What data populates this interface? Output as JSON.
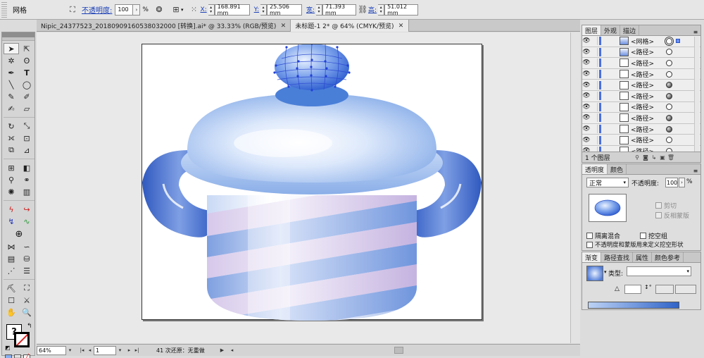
{
  "control_bar": {
    "mode_label": "网格",
    "opacity_link": "不透明度:",
    "opacity_value": "100",
    "opacity_unit": "%",
    "x_label": "X:",
    "x_value": "168.891 mm",
    "y_label": "Y:",
    "y_value": "25.506 mm",
    "w_label": "宽:",
    "w_value": "71.393 mm",
    "h_label": "高:",
    "h_value": "51.012 mm"
  },
  "doc_tabs": [
    {
      "label": "Nipic_24377523_20180909160538032000 [转换].ai* @ 33.33% (RGB/预览)"
    },
    {
      "label": "未标题-1 2* @ 64% (CMYK/预览)"
    }
  ],
  "status_bar": {
    "zoom": "64%",
    "page": "1",
    "message": "41 次还原：无重做"
  },
  "layers_panel": {
    "tabs": [
      "图层",
      "外观",
      "描边"
    ],
    "rows": [
      {
        "name": "<网格>",
        "target": "dbl",
        "selected": true,
        "thumb": "grad"
      },
      {
        "name": "<路径>",
        "target": "empty",
        "selected": false,
        "thumb": "grad"
      },
      {
        "name": "<路径>",
        "target": "empty",
        "selected": false,
        "thumb": "plain"
      },
      {
        "name": "<路径>",
        "target": "empty",
        "selected": false,
        "thumb": "plain"
      },
      {
        "name": "<路径>",
        "target": "filled",
        "selected": false,
        "thumb": "plain"
      },
      {
        "name": "<路径>",
        "target": "filled",
        "selected": false,
        "thumb": "plain"
      },
      {
        "name": "<路径>",
        "target": "empty",
        "selected": false,
        "thumb": "plain"
      },
      {
        "name": "<路径>",
        "target": "filled",
        "selected": false,
        "thumb": "plain"
      },
      {
        "name": "<路径>",
        "target": "filled",
        "selected": false,
        "thumb": "plain"
      },
      {
        "name": "<路径>",
        "target": "empty",
        "selected": false,
        "thumb": "plain"
      },
      {
        "name": "<路径>",
        "target": "empty",
        "selected": false,
        "thumb": "plain"
      }
    ],
    "footer_count": "1 个图层"
  },
  "transparency_panel": {
    "tabs": [
      "透明度",
      "颜色"
    ],
    "blend_mode": "正常",
    "opacity_label": "不透明度:",
    "opacity_value": "100",
    "opacity_unit": "%",
    "clip_label": "剪切",
    "invert_mask_label": "反相蒙版",
    "isolate_blending_label": "隔离混合",
    "knockout_group_label": "挖空组",
    "opacity_mask_label": "不透明度和蒙版用来定义挖空形状"
  },
  "gradient_panel": {
    "tabs": [
      "渐变",
      "路径查找",
      "属性",
      "颜色参考"
    ],
    "type_label": "类型:"
  },
  "colors": {
    "accent_link": "#1a3fb6",
    "layer_color": "#4a6fe0",
    "pot_blue": "#8fb2ea",
    "pot_stripe_pink": "#d8c6e6",
    "handle_blue": "#3c66c8"
  }
}
